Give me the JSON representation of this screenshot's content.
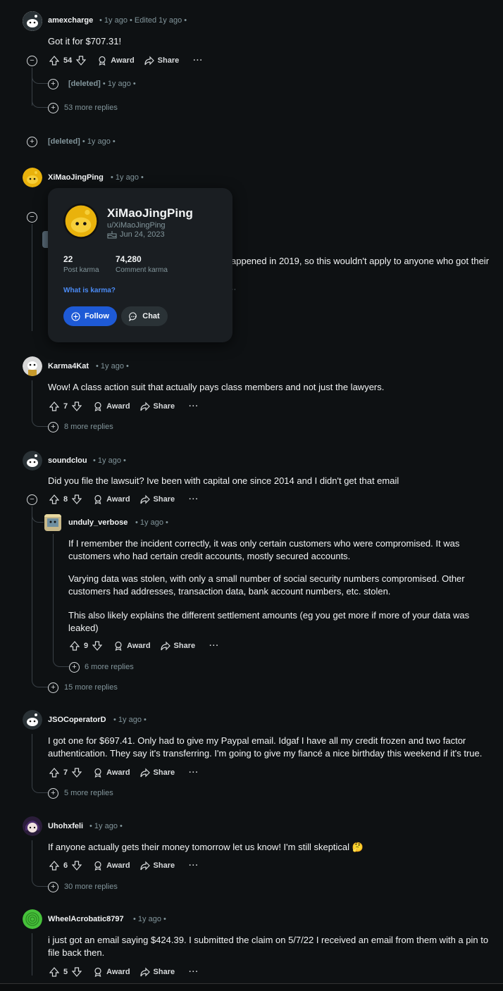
{
  "labels": {
    "award": "Award",
    "share": "Share",
    "more": "···",
    "ago": "1y ago",
    "edited": "Edited 1y ago",
    "deleted": "[deleted]"
  },
  "colors": {
    "background": "#0e1113",
    "accent": "#1e5ad6",
    "link": "#4b8bf5",
    "meta": "#82959b"
  },
  "comments": {
    "c1": {
      "username": "amexcharge",
      "body": "Got it for $707.31!",
      "votes": "54",
      "reply_deleted": "[deleted]",
      "more_replies": "53 more replies"
    },
    "c2": {
      "username": "[deleted]"
    },
    "c3": {
      "username": "XiMaoJingPing",
      "body_visible": "appened in 2019, so this wouldn't apply to anyone who got their"
    },
    "c4": {
      "username": "Karma4Kat",
      "body": "Wow! A class action suit that actually pays class members and not just the lawyers.",
      "votes": "7",
      "more_replies": "8 more replies"
    },
    "c5": {
      "username": "soundclou",
      "body": "Did you file the lawsuit? Ive been with capital one since 2014 and I didn't get that email",
      "votes": "8",
      "more_replies": "15 more replies"
    },
    "c5r": {
      "username": "unduly_verbose",
      "p1": "If I remember the incident correctly, it was only certain customers who were compromised. It was customers who had certain credit accounts, mostly secured accounts.",
      "p2": "Varying data was stolen, with only a small number of social security numbers compromised. Other customers had addresses, transaction data, bank account numbers, etc. stolen.",
      "p3": "This also likely explains the different settlement amounts (eg you get more if more of your data was leaked)",
      "votes": "9",
      "more_replies": "6 more replies"
    },
    "c6": {
      "username": "JSOCoperatorD",
      "body": "I got one for $697.41. Only had to give my Paypal email. Idgaf I have all my credit frozen and two factor authentication. They say it's transferring. I'm going to give my fiancé a nice birthday this weekend if it's true.",
      "votes": "7",
      "more_replies": "5 more replies"
    },
    "c7": {
      "username": "Uhohxfeli",
      "body": "If anyone actually gets their money tomorrow let us know! I'm still skeptical 🤔",
      "votes": "6",
      "more_replies": "30 more replies"
    },
    "c8": {
      "username": "WheelAcrobatic8797",
      "body": "i just got an email saying $424.39. I submitted the claim on 5/7/22 I received an email from them with a pin to file back then.",
      "votes": "5"
    }
  },
  "profile_card": {
    "display_name": "XiMaoJingPing",
    "handle": "u/XiMaoJingPing",
    "cake_day": "Jun 24, 2023",
    "post_karma": "22",
    "post_karma_label": "Post karma",
    "comment_karma": "74,280",
    "comment_karma_label": "Comment karma",
    "karma_link": "What is karma?",
    "follow_label": "Follow",
    "chat_label": "Chat"
  }
}
